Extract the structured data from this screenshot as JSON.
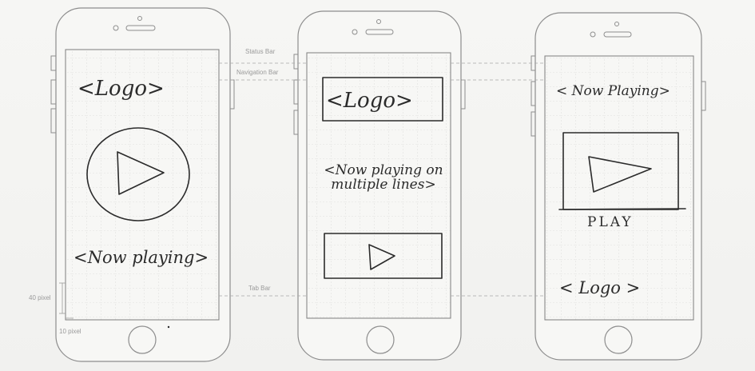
{
  "annotations": {
    "status_bar": "Status Bar",
    "navigation_bar": "Navigation Bar",
    "tab_bar": "Tab Bar",
    "height_40": "40 pixel",
    "width_10": "10 pixel"
  },
  "wireframe_1": {
    "logo": "<Logo>",
    "now_playing": "<Now playing>"
  },
  "wireframe_2": {
    "logo": "<Logo>",
    "now_playing_multi": "<Now playing on multiple lines>"
  },
  "wireframe_3": {
    "now_playing": "< Now Playing>",
    "play_label": "PLAY",
    "logo": "< Logo >"
  }
}
